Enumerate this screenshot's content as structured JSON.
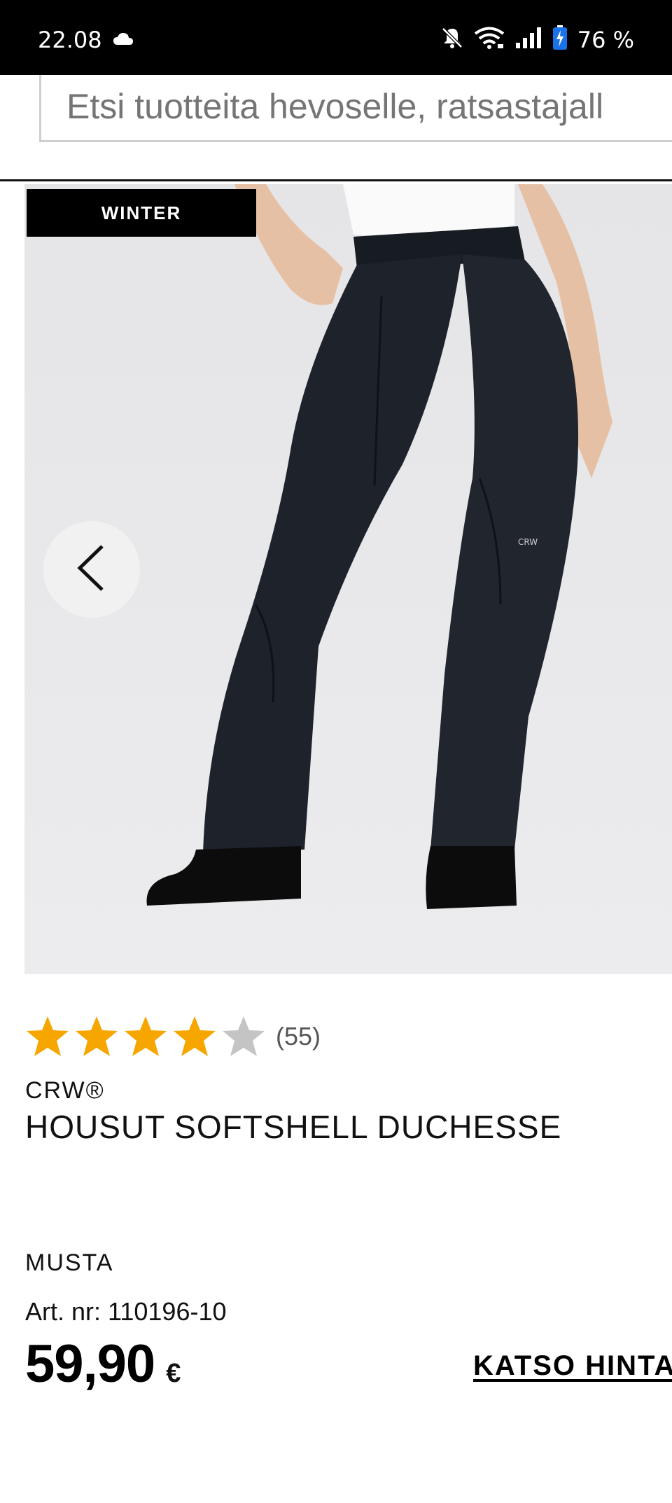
{
  "status_bar": {
    "time": "22.08",
    "battery": "76 %",
    "icons": [
      "cloud-icon",
      "bell-muted-icon",
      "wifi-icon",
      "signal-icon",
      "battery-charging-icon"
    ]
  },
  "search": {
    "placeholder": "Etsi tuotteita hevoselle, ratsastajall",
    "icon": "search-field"
  },
  "product": {
    "badge": "WINTER",
    "image_icon": "product-photo",
    "prev_icon": "chevron-left-icon",
    "rating": {
      "value": 4,
      "max": 5,
      "count_label": "(55)"
    },
    "brand": "CRW®",
    "name": "HOUSUT SOFTSHELL DUCHESSE",
    "color": "MUSTA",
    "article": "Art. nr: 110196-10",
    "price": "59,90",
    "currency": "€",
    "see_price_label": "KATSO HINTA"
  },
  "colors": {
    "star_filled": "#F7A600",
    "star_empty": "#C4C4C4",
    "badge_bg": "#000000"
  }
}
